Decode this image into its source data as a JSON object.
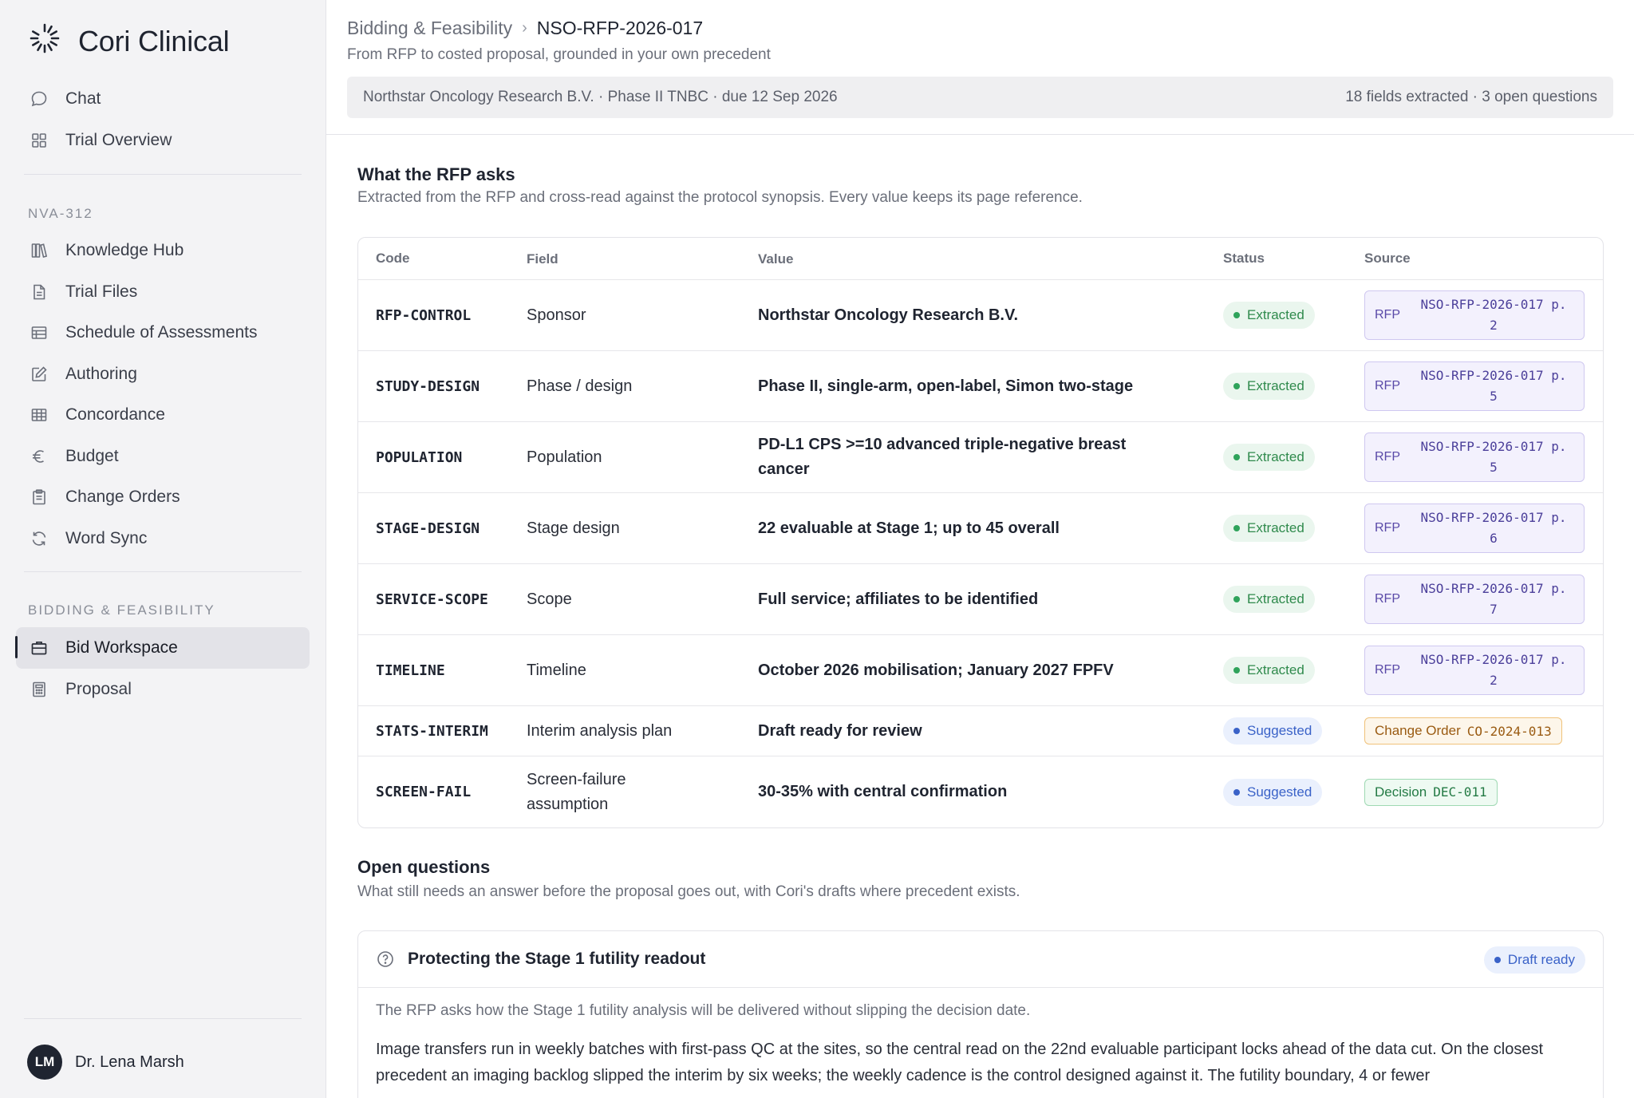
{
  "app": {
    "name": "Cori Clinical"
  },
  "sidebar": {
    "top_items": [
      {
        "label": "Chat",
        "icon": "chat-bubble-icon"
      },
      {
        "label": "Trial Overview",
        "icon": "grid-icon"
      }
    ],
    "trial_section": "NVA-312",
    "trial_items": [
      {
        "label": "Knowledge Hub",
        "icon": "books-icon"
      },
      {
        "label": "Trial Files",
        "icon": "file-icon"
      },
      {
        "label": "Schedule of Assessments",
        "icon": "table-list-icon"
      },
      {
        "label": "Authoring",
        "icon": "edit-icon"
      },
      {
        "label": "Concordance",
        "icon": "table-grid-icon"
      },
      {
        "label": "Budget",
        "icon": "euro-icon"
      },
      {
        "label": "Change Orders",
        "icon": "clipboard-icon"
      },
      {
        "label": "Word Sync",
        "icon": "sync-icon"
      }
    ],
    "bidding_section": "BIDDING & FEASIBILITY",
    "bidding_items": [
      {
        "label": "Bid Workspace",
        "icon": "briefcase-icon",
        "active": true
      },
      {
        "label": "Proposal",
        "icon": "calculator-icon"
      }
    ],
    "user": {
      "initials": "LM",
      "name": "Dr. Lena Marsh"
    }
  },
  "header": {
    "breadcrumb_parent": "Bidding & Feasibility",
    "breadcrumb_separator": "›",
    "breadcrumb_current": "NSO-RFP-2026-017",
    "subtitle": "From RFP to costed proposal, grounded in your own precedent",
    "context_left": "Northstar Oncology Research B.V. · Phase II TNBC · due 12 Sep 2026",
    "context_right": "18 fields extracted · 3 open questions"
  },
  "rfp_section": {
    "title": "What the RFP asks",
    "description": "Extracted from the RFP and cross-read against the protocol synopsis. Every value keeps its page reference.",
    "columns": {
      "code": "Code",
      "field": "Field",
      "value": "Value",
      "status": "Status",
      "source": "Source"
    },
    "rows": [
      {
        "code": "RFP-CONTROL",
        "field": "Sponsor",
        "value": "Northstar Oncology Research B.V.",
        "status": "Extracted",
        "source_kind": "RFP",
        "source_ref": "NSO-RFP-2026-017 p. 2"
      },
      {
        "code": "STUDY-DESIGN",
        "field": "Phase / design",
        "value": "Phase II, single-arm, open-label, Simon two-stage",
        "status": "Extracted",
        "source_kind": "RFP",
        "source_ref": "NSO-RFP-2026-017 p. 5"
      },
      {
        "code": "POPULATION",
        "field": "Population",
        "value": "PD-L1 CPS >=10 advanced triple-negative breast cancer",
        "status": "Extracted",
        "source_kind": "RFP",
        "source_ref": "NSO-RFP-2026-017 p. 5"
      },
      {
        "code": "STAGE-DESIGN",
        "field": "Stage design",
        "value": "22 evaluable at Stage 1; up to 45 overall",
        "status": "Extracted",
        "source_kind": "RFP",
        "source_ref": "NSO-RFP-2026-017 p. 6"
      },
      {
        "code": "SERVICE-SCOPE",
        "field": "Scope",
        "value": "Full service; affiliates to be identified",
        "status": "Extracted",
        "source_kind": "RFP",
        "source_ref": "NSO-RFP-2026-017 p. 7"
      },
      {
        "code": "TIMELINE",
        "field": "Timeline",
        "value": "October 2026 mobilisation; January 2027 FPFV",
        "status": "Extracted",
        "source_kind": "RFP",
        "source_ref": "NSO-RFP-2026-017 p. 2"
      },
      {
        "code": "STATS-INTERIM",
        "field": "Interim analysis plan",
        "value": "Draft ready for review",
        "status": "Suggested",
        "source_kind": "Change Order",
        "source_ref": "CO-2024-013"
      },
      {
        "code": "SCREEN-FAIL",
        "field": "Screen-failure assumption",
        "value": "30-35% with central confirmation",
        "status": "Suggested",
        "source_kind": "Decision",
        "source_ref": "DEC-011"
      }
    ]
  },
  "questions_section": {
    "title": "Open questions",
    "description": "What still needs an answer before the proposal goes out, with Cori's drafts where precedent exists.",
    "question": {
      "title": "Protecting the Stage 1 futility readout",
      "badge": "Draft ready",
      "ask": "The RFP asks how the Stage 1 futility analysis will be delivered without slipping the decision date.",
      "body": "Image transfers run in weekly batches with first-pass QC at the sites, so the central read on the 22nd evaluable participant locks ahead of the data cut. On the closest precedent an imaging backlog slipped the interim by six weeks; the weekly cadence is the control designed against it. The futility boundary, 4 or fewer"
    }
  },
  "colors": {
    "accent": "#1f2430",
    "extracted": "#2fa35b",
    "suggested": "#3a62c8",
    "rfp_source": "#4b3f9a",
    "change_order": "#9a5b12",
    "decision": "#237a44"
  }
}
